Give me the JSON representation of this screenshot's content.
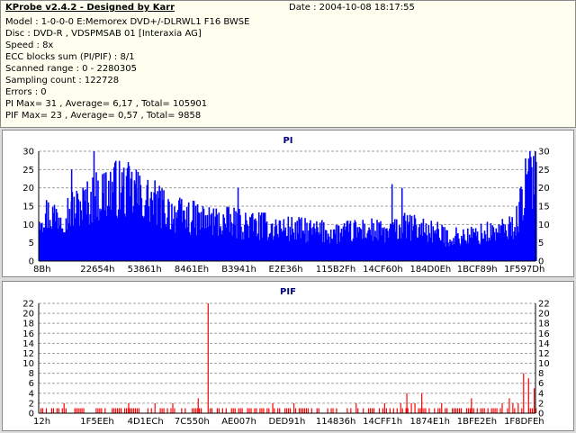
{
  "header": {
    "title": "KProbe v2.4.2 - Designed by Karr",
    "date": "Date : 2004-10-08 18:17:55",
    "lines": [
      "Model : 1-0-0-0 E:Memorex DVD+/-DLRWL1 F16 BWSE",
      "Disc : DVD-R , VDSPMSAB 01 [Interaxia AG]",
      "Speed : 8x",
      "ECC blocks sum (PI/PIF) : 8/1",
      "Scanned range : 0 - 2280305",
      "Sampling count : 122728",
      "Errors : 0",
      "PI Max= 31 , Average= 6,17 , Total= 105901",
      "PIF Max= 23 , Average= 0,57 , Total= 9858"
    ]
  },
  "colors": {
    "pi_fill": "#0000ff",
    "pif_bar": "#ff0000",
    "title": "#000080",
    "grid": "#a0a0a0"
  },
  "chart_data": [
    {
      "type": "bar",
      "title": "PI",
      "ylim": [
        0,
        30
      ],
      "yticks": [
        0,
        5,
        10,
        15,
        20,
        25,
        30
      ],
      "xticks": [
        "8Bh",
        "22654h",
        "53861h",
        "8461Eh",
        "B3941h",
        "E2E36h",
        "115B2Fh",
        "14CF60h",
        "184D0Eh",
        "1BCF89h",
        "1F597Dh"
      ],
      "grid": true,
      "max": 31,
      "average": 6.17,
      "profile": [
        [
          0,
          14
        ],
        [
          0.03,
          13
        ],
        [
          0.07,
          15
        ],
        [
          0.1,
          17
        ],
        [
          0.12,
          19
        ],
        [
          0.15,
          21
        ],
        [
          0.18,
          20
        ],
        [
          0.21,
          18
        ],
        [
          0.24,
          16
        ],
        [
          0.28,
          13
        ],
        [
          0.32,
          12
        ],
        [
          0.38,
          11
        ],
        [
          0.45,
          10
        ],
        [
          0.52,
          9
        ],
        [
          0.6,
          8
        ],
        [
          0.66,
          9
        ],
        [
          0.7,
          8
        ],
        [
          0.74,
          10
        ],
        [
          0.78,
          9
        ],
        [
          0.82,
          7
        ],
        [
          0.86,
          7
        ],
        [
          0.9,
          8
        ],
        [
          0.94,
          9
        ],
        [
          0.96,
          11
        ],
        [
          0.975,
          20
        ],
        [
          1.0,
          28
        ]
      ],
      "spikes": [
        [
          0.11,
          30
        ],
        [
          0.065,
          25
        ],
        [
          0.195,
          25
        ],
        [
          0.4,
          20
        ],
        [
          0.71,
          21
        ],
        [
          0.73,
          20
        ],
        [
          0.985,
          28
        ]
      ]
    },
    {
      "type": "bar",
      "title": "PIF",
      "ylim": [
        0,
        22
      ],
      "yticks": [
        0,
        2,
        4,
        6,
        8,
        10,
        12,
        14,
        16,
        18,
        20,
        22
      ],
      "xticks": [
        "12h",
        "1F5EEh",
        "4D1ECh",
        "7C550h",
        "AE007h",
        "DED91h",
        "114836h",
        "14CFF1h",
        "1874E1h",
        "1BFE2Eh",
        "1F8DFEh"
      ],
      "grid": true,
      "max": 23,
      "average": 0.57,
      "profile": [
        [
          0,
          1
        ],
        [
          0.2,
          1
        ],
        [
          0.4,
          1
        ],
        [
          0.55,
          1
        ],
        [
          0.7,
          1
        ],
        [
          0.74,
          2
        ],
        [
          0.78,
          1
        ],
        [
          0.9,
          1
        ],
        [
          0.96,
          2
        ],
        [
          0.98,
          4
        ],
        [
          1.0,
          5
        ]
      ],
      "spikes": [
        [
          0.34,
          23
        ],
        [
          0.05,
          2
        ],
        [
          0.18,
          2
        ],
        [
          0.32,
          3
        ],
        [
          0.47,
          2
        ],
        [
          0.74,
          4
        ],
        [
          0.77,
          4
        ],
        [
          0.81,
          2
        ],
        [
          0.87,
          3
        ],
        [
          0.975,
          8
        ],
        [
          0.985,
          7
        ]
      ]
    }
  ]
}
